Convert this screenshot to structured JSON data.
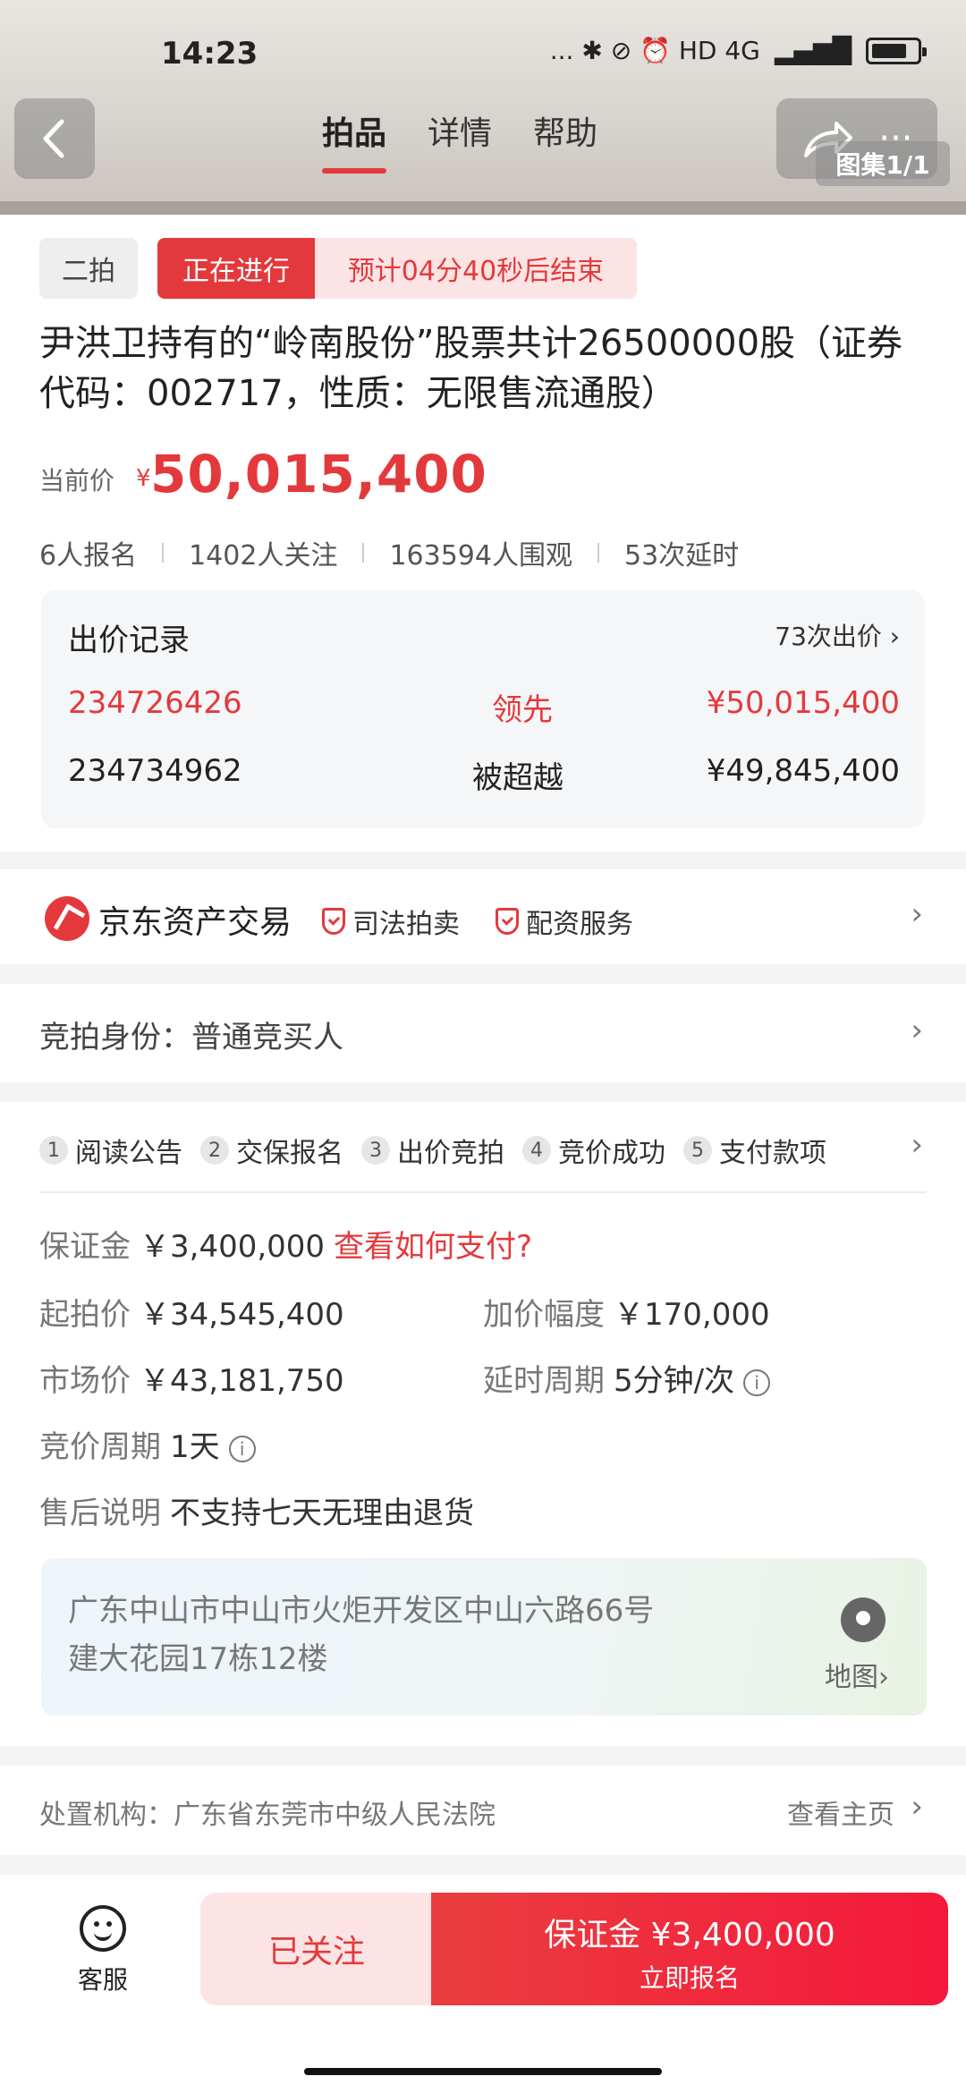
{
  "status_bar": {
    "time": "14:23",
    "indicators": "... ✱ ⊘ ⏰ HD 4G"
  },
  "nav": {
    "tabs": [
      {
        "label": "拍品"
      },
      {
        "label": "详情"
      },
      {
        "label": "帮助"
      }
    ],
    "gallery": "图集1/1"
  },
  "auction": {
    "round": "二拍",
    "status": "正在进行",
    "countdown": "预计04分40秒后结束",
    "title": "尹洪卫持有的“岭南股份”股票共计26500000股（证券代码：002717，性质：无限售流通股）",
    "current_price_label": "当前价",
    "currency_symbol": "¥",
    "current_price": "50,015,400",
    "stats": {
      "signups": "6人报名",
      "follows": "1402人关注",
      "views": "163594人围观",
      "extensions": "53次延时"
    }
  },
  "bid_records": {
    "title": "出价记录",
    "count": "73次出价",
    "rows": [
      {
        "id": "234726426",
        "state": "领先",
        "amount": "¥50,015,400"
      },
      {
        "id": "234734962",
        "state": "被超越",
        "amount": "¥49,845,400"
      }
    ]
  },
  "seller": {
    "name": "京东资产交易",
    "badges": [
      "司法拍卖",
      "配资服务"
    ]
  },
  "identity": {
    "text": "竞拍身份：普通竞买人"
  },
  "steps": [
    {
      "num": "1",
      "label": "阅读公告"
    },
    {
      "num": "2",
      "label": "交保报名"
    },
    {
      "num": "3",
      "label": "出价竞拍"
    },
    {
      "num": "4",
      "label": "竞价成功"
    },
    {
      "num": "5",
      "label": "支付款项"
    }
  ],
  "details": {
    "deposit_label": "保证金",
    "deposit_value": "￥3,400,000",
    "deposit_link": "查看如何支付?",
    "start_price_label": "起拍价",
    "start_price_value": "￥34,545,400",
    "increment_label": "加价幅度",
    "increment_value": "￥170,000",
    "market_price_label": "市场价",
    "market_price_value": "￥43,181,750",
    "delay_label": "延时周期",
    "delay_value": "5分钟/次",
    "cycle_label": "竞价周期",
    "cycle_value": "1天",
    "aftersale_label": "售后说明",
    "aftersale_value": "不支持七天无理由退货"
  },
  "address": {
    "line1": "广东中山市中山市火炬开发区中山六路66号",
    "line2": "建大花园17栋12楼",
    "map_label": "地图"
  },
  "court": {
    "text": "处置机构：广东省东莞市中级人民法院",
    "link": "查看主页"
  },
  "bottom": {
    "service_label": "客服",
    "follow_label": "已关注",
    "signup_main": "保证金 ¥3,400,000",
    "signup_sub": "立即报名"
  },
  "colors": {
    "accent": "#e4393c",
    "accent_light": "#fde4e4"
  }
}
